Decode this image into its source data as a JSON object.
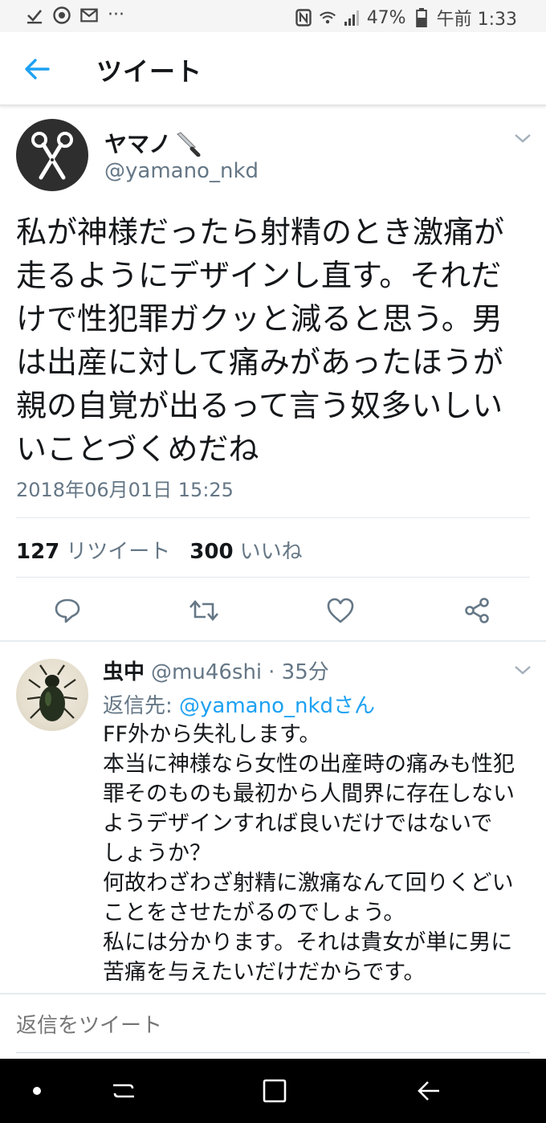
{
  "status_bar": {
    "icons_left": [
      "download-check-icon",
      "chrome-icon",
      "gmail-icon",
      "more-dots-icon"
    ],
    "icons_right": [
      "nfc-icon",
      "wifi-icon",
      "signal-icon",
      "battery-icon"
    ],
    "dots": "···",
    "battery": "47%",
    "time": "午前 1:33"
  },
  "header": {
    "title": "ツイート",
    "back_icon": "back-arrow-icon"
  },
  "tweet": {
    "author_name": "ヤマノ",
    "author_emoji": "knife-icon",
    "author_handle": "@yamano_nkd",
    "text": "私が神様だったら射精のとき激痛が\n走るようにデザインし直す。それだ\nけで性犯罪ガクッと減ると思う。男\nは出産に対して痛みがあったほうが\n親の自覚が出るって言う奴多いしい\nいことづくめだね",
    "timestamp": "2018年06月01日 15:25",
    "retweet_count": "127",
    "retweet_label": "リツイート",
    "like_count": "300",
    "like_label": "いいね"
  },
  "reply": {
    "author_name": "虫中",
    "author_handle": "@mu46shi",
    "age": "· 35分",
    "reply_to_prefix": "返信先: ",
    "reply_to_mention": "@yamano_nkdさん",
    "text": "FF外から失礼します。\n本当に神様なら女性の出産時の痛みも性犯\n罪そのものも最初から人間界に存在しない\nようデザインすれば良いだけではないで\nしょうか？\n何故わざわざ射精に激痛なんて回りくどい\nことをさせたがるのでしょう。\n私には分かります。それは貴女が単に男に\n苦痛を与えたいだけだからです。"
  },
  "compose": {
    "placeholder": "返信をツイート"
  },
  "colors": {
    "accent": "#1da1f2",
    "text": "#14171a",
    "secondary": "#657786",
    "divider": "#e1e8ed"
  }
}
